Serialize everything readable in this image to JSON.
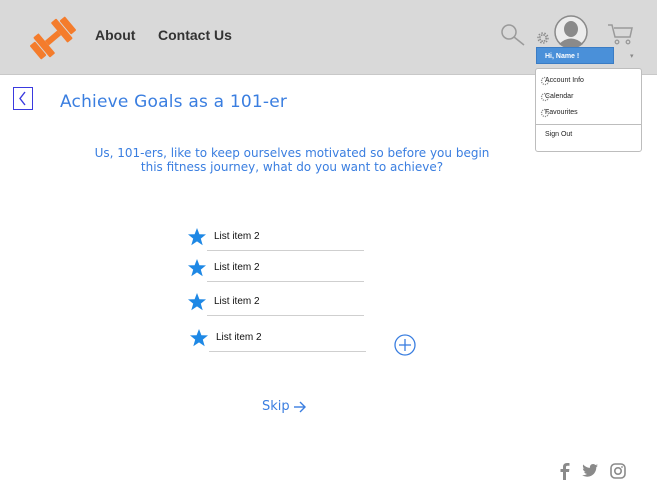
{
  "nav": {
    "about_label": "About",
    "contact_label": "Contact Us"
  },
  "user_menu": {
    "greeting": "Hi, Name !",
    "items": [
      {
        "label": "Account Info"
      },
      {
        "label": "Calendar"
      },
      {
        "label": "Favourites"
      }
    ],
    "sign_out_label": "Sign Out"
  },
  "page": {
    "title": "Achieve Goals as a 101-er",
    "intro_line1": "Us, 101-ers, like to keep ourselves motivated so before you begin",
    "intro_line2": "this fitness journey, what do you want to achieve?"
  },
  "goals": [
    {
      "label": "List item 2"
    },
    {
      "label": "List item 2"
    },
    {
      "label": "List item 2"
    },
    {
      "label": "List item 2"
    }
  ],
  "skip_label": "Skip",
  "colors": {
    "accent": "#3a7ee0",
    "logo": "#f47c2c",
    "header_bg": "#d9d9d9",
    "star": "#1e88e5"
  },
  "icons": [
    "dumbbell-logo",
    "search-icon",
    "gear-icon",
    "avatar-icon",
    "cart-icon",
    "back-icon",
    "star-icon",
    "plus-circle-icon",
    "arrow-right-icon",
    "facebook-icon",
    "twitter-icon",
    "instagram-icon"
  ]
}
